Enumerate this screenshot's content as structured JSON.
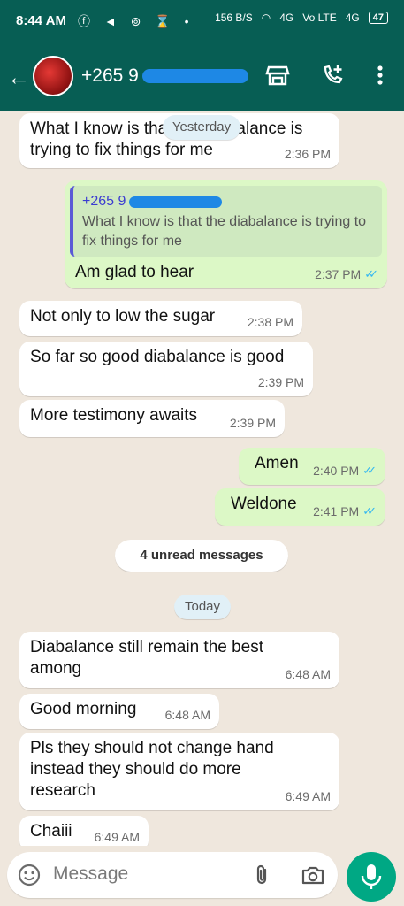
{
  "statusbar": {
    "time": "8:44 AM",
    "net_speed": "156 B/S",
    "signal_1": "4G",
    "signal_2": "Vo LTE",
    "signal_3": "4G",
    "battery": "47"
  },
  "header": {
    "contact": "+265 9",
    "icons": [
      "back-arrow-icon",
      "shop-icon",
      "add-call-icon",
      "more-icon"
    ]
  },
  "chat": {
    "floating_date": "Yesterday",
    "messages": [
      {
        "dir": "in",
        "text": "What I know is that the diabalance is trying to fix things for me",
        "time": "2:36 PM"
      },
      {
        "dir": "out",
        "reply_name": "+265 9",
        "reply_text": "What I know is that the diabalance is trying to fix things for me",
        "text": "Am glad to hear",
        "time": "2:37 PM"
      },
      {
        "dir": "in",
        "text": "Not only to low the sugar",
        "time": "2:38 PM"
      },
      {
        "dir": "in",
        "text": "So far so good diabalance is good",
        "time": "2:39 PM"
      },
      {
        "dir": "in",
        "text": "More testimony awaits",
        "time": "2:39 PM"
      },
      {
        "dir": "out",
        "text": "Amen",
        "time": "2:40 PM"
      },
      {
        "dir": "out",
        "text": "Weldone",
        "time": "2:41 PM"
      },
      {
        "dir": "in",
        "text": "Diabalance still remain the best among",
        "time": "6:48 AM"
      },
      {
        "dir": "in",
        "text": "Good morning",
        "time": "6:48 AM"
      },
      {
        "dir": "in",
        "text": "Pls they should not change hand instead they should do more research",
        "time": "6:49 AM"
      },
      {
        "dir": "in",
        "text": "Chaiii",
        "time": "6:49 AM"
      }
    ],
    "unread_label": "4 unread messages",
    "today_label": "Today"
  },
  "input": {
    "placeholder": "Message"
  },
  "colors": {
    "header": "#075e54",
    "bg": "#efe7dd",
    "out_bubble": "#dcf8c6",
    "mic": "#00a884",
    "ticks": "#34b7f1"
  }
}
